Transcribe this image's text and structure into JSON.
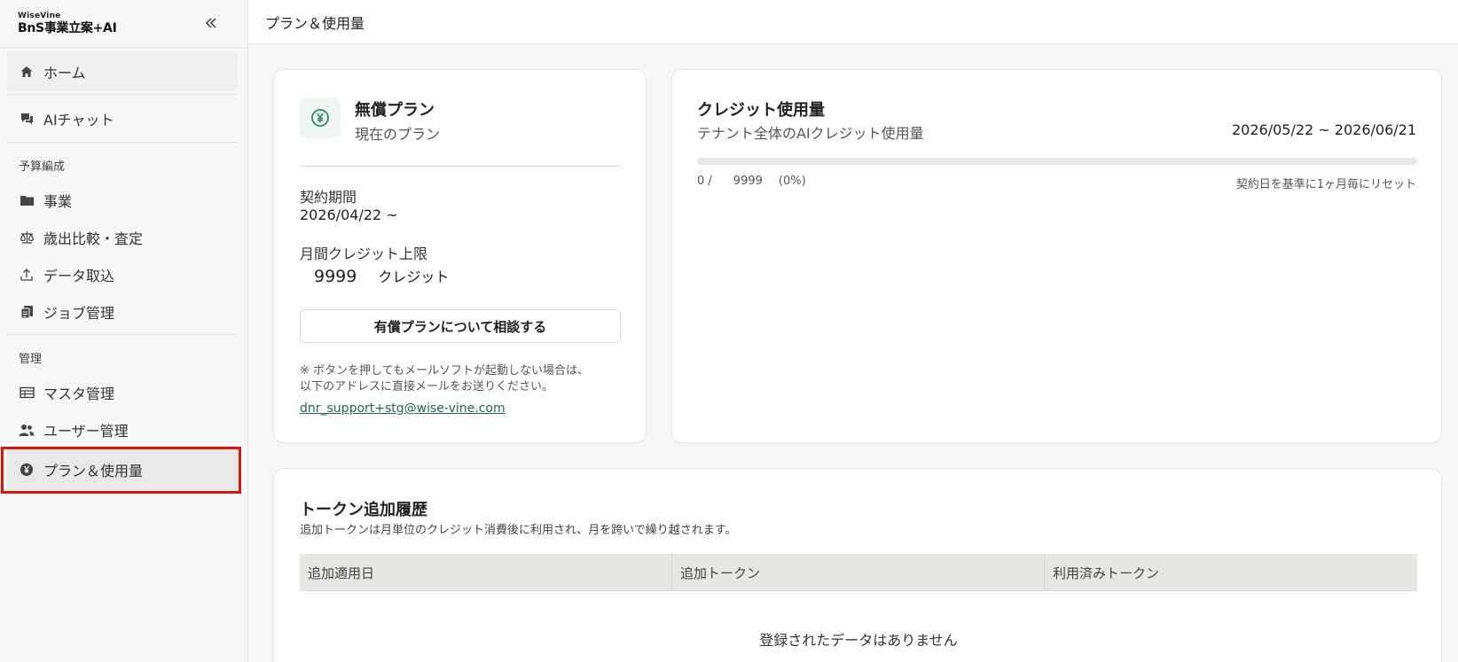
{
  "sidebar": {
    "brand_small": "WiseVine",
    "brand_main": "BnS事業立案+AI",
    "home": "ホーム",
    "ai_chat": "AIチャット",
    "section_budget": "予算編成",
    "business": "事業",
    "comparison": "歳出比較・査定",
    "data_import": "データ取込",
    "job_mgmt": "ジョブ管理",
    "section_admin": "管理",
    "master_mgmt": "マスタ管理",
    "user_mgmt": "ユーザー管理",
    "plan_usage": "プラン＆使用量"
  },
  "header": {
    "title": "プラン＆使用量"
  },
  "plan": {
    "name": "無償プラン",
    "sub": "現在のプラン",
    "contract_label": "契約期間",
    "contract_value": "2026/04/22 ~",
    "monthly_label": "月間クレジット上限",
    "monthly_value": "9999",
    "monthly_unit": "クレジット",
    "consult_button": "有償プランについて相談する",
    "note_line1": "※ ボタンを押してもメールソフトが起動しない場合は、",
    "note_line2": "以下のアドレスに直接メールをお送りください。",
    "email": "dnr_support+stg@wise-vine.com"
  },
  "usage": {
    "title": "クレジット使用量",
    "sub": "テナント全体のAIクレジット使用量",
    "period": "2026/05/22 ~ 2026/06/21",
    "used": "0 /",
    "limit": "9999",
    "percent": "(0%)",
    "progress_fraction": 0,
    "reset_note": "契約日を基準に1ヶ月毎にリセット"
  },
  "history": {
    "title": "トークン追加履歴",
    "sub": "追加トークンは月単位のクレジット消費後に利用され、月を跨いで繰り越されます。",
    "columns": [
      "追加適用日",
      "追加トークン",
      "利用済みトークン"
    ],
    "empty": "登録されたデータはありません"
  },
  "colors": {
    "accent": "#2e8b63",
    "highlight": "#e0140f"
  }
}
